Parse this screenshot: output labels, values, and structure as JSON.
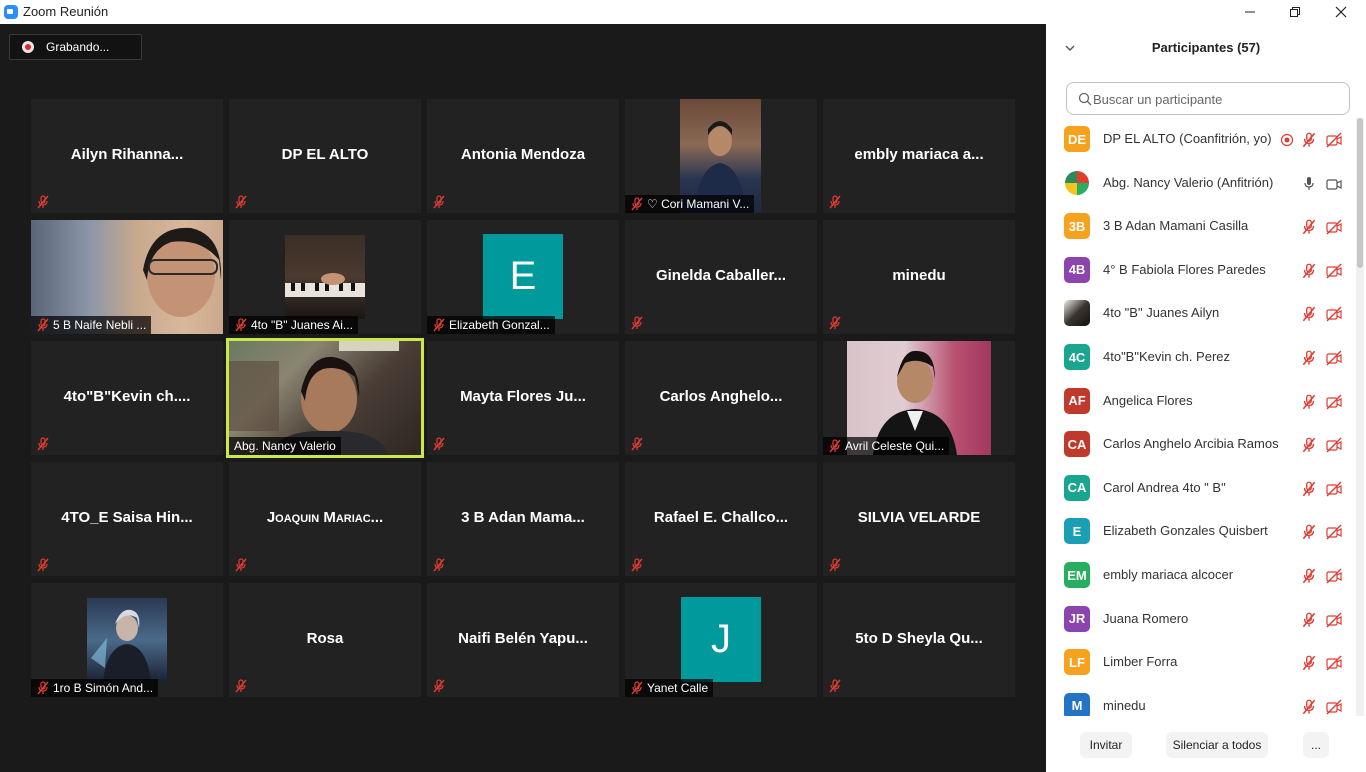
{
  "window": {
    "title": "Zoom Reunión",
    "controls": [
      "—",
      "❐",
      "✕"
    ]
  },
  "recording": {
    "label": "Grabando..."
  },
  "colors": {
    "mute_red": "#d93025",
    "active_border": "#c9e84b",
    "tile_bg": "#222222"
  },
  "tiles": {
    "ailyn": "Ailyn  Rihanna...",
    "dp": "DP EL ALTO",
    "antonia": "Antonia Mendoza",
    "cori": "♡ Cori Mamani V...",
    "embly": "embly  mariaca  a...",
    "naife": "5 B Naife Nebli ...",
    "juanes": "4to \"B\" Juanes Ai...",
    "elizabeth": "Elizabeth Gonzal...",
    "elizabeth_initial": "E",
    "ginelda": "Ginelda  Caballer...",
    "minedu": "minedu",
    "kevin": "4to\"B\"Kevin  ch....",
    "nancy": "Abg. Nancy Valerio",
    "mayta": "Mayta Flores Ju...",
    "carlos": "Carlos  Anghelo...",
    "avril": "Avril Celeste Qui...",
    "saisa": "4TO_E  Saisa  Hin...",
    "joaquin": "Joaquin  Mariac...",
    "adan": "3 B  Adan Mama...",
    "rafael": "Rafael  E.  Challco...",
    "silvia": "SILVIA VELARDE",
    "simon": "1ro B Simón And...",
    "rosa": "Rosa",
    "naifi": "Naifi  Belén  Yapu...",
    "yanet": "Yanet Calle",
    "yanet_initial": "J",
    "sheyla": "5to D Sheyla Qu..."
  },
  "panel": {
    "title": "Participantes (57)",
    "search_placeholder": "Buscar un participante",
    "participants": [
      {
        "initials": "DE",
        "color": "#f6a21e",
        "name": "DP EL ALTO (Coanfitrión, yo)"
      },
      {
        "initials": "",
        "color": "#ffffff",
        "name": "Abg. Nancy Valerio (Anfitrión)"
      },
      {
        "initials": "3B",
        "color": "#f6a21e",
        "name": "3 B Adan Mamani Casilla"
      },
      {
        "initials": "4B",
        "color": "#8e44ad",
        "name": "4° B Fabiola Flores Paredes"
      },
      {
        "initials": "",
        "color": "#444444",
        "name": "4to \"B\" Juanes Ailyn"
      },
      {
        "initials": "4C",
        "color": "#1aa58f",
        "name": "4to\"B\"Kevin ch. Perez"
      },
      {
        "initials": "AF",
        "color": "#c0392b",
        "name": "Angelica Flores"
      },
      {
        "initials": "CA",
        "color": "#c0392b",
        "name": "Carlos Anghelo Arcibia Ramos"
      },
      {
        "initials": "CA",
        "color": "#1aa58f",
        "name": "Carol Andrea 4to \" B\""
      },
      {
        "initials": "E",
        "color": "#1a9fb5",
        "name": "Elizabeth Gonzales Quisbert"
      },
      {
        "initials": "EM",
        "color": "#27ae60",
        "name": "embly mariaca alcocer"
      },
      {
        "initials": "JR",
        "color": "#8e44ad",
        "name": "Juana Romero"
      },
      {
        "initials": "LF",
        "color": "#f6a21e",
        "name": "Limber Forra"
      },
      {
        "initials": "M",
        "color": "#2374c6",
        "name": "minedu"
      }
    ],
    "footer": {
      "invite": "Invitar",
      "mute_all": "Silenciar a todos",
      "more": "..."
    }
  }
}
